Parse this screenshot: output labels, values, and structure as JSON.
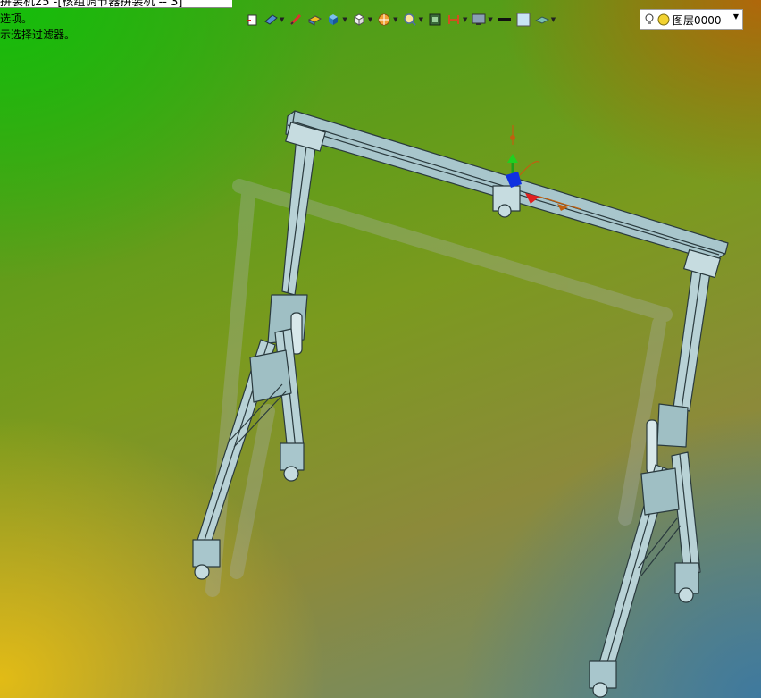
{
  "window": {
    "title_fragment": "拼装机25 -[核组调节器拼装机 -- 3]"
  },
  "hints": [
    "选项。",
    "示选择过滤器。"
  ],
  "toolbar": {
    "items": [
      {
        "icon": "sketch-icon",
        "has_dropdown": false
      },
      {
        "icon": "view-orient-icon",
        "has_dropdown": true
      },
      {
        "icon": "pen-icon",
        "has_dropdown": false
      },
      {
        "icon": "layer-box-icon",
        "has_dropdown": false
      },
      {
        "icon": "shaded-cube-icon",
        "has_dropdown": true
      },
      {
        "icon": "wire-cube-icon",
        "has_dropdown": true
      },
      {
        "icon": "render-wheel-icon",
        "has_dropdown": true
      },
      {
        "icon": "zoom-fit-icon",
        "has_dropdown": true
      },
      {
        "icon": "frame-icon",
        "has_dropdown": false
      },
      {
        "icon": "section-icon",
        "has_dropdown": true
      },
      {
        "icon": "monitor-icon",
        "has_dropdown": true
      },
      {
        "icon": "line-color-icon",
        "has_dropdown": false
      },
      {
        "icon": "fill-color-icon",
        "has_dropdown": false
      },
      {
        "icon": "plane-icon",
        "has_dropdown": true
      }
    ],
    "layer": {
      "label": "图层0000"
    }
  },
  "colors": {
    "frame": "#a8c6cc",
    "edge": "#2a3a3e",
    "shadow": "#9aa5a0"
  }
}
